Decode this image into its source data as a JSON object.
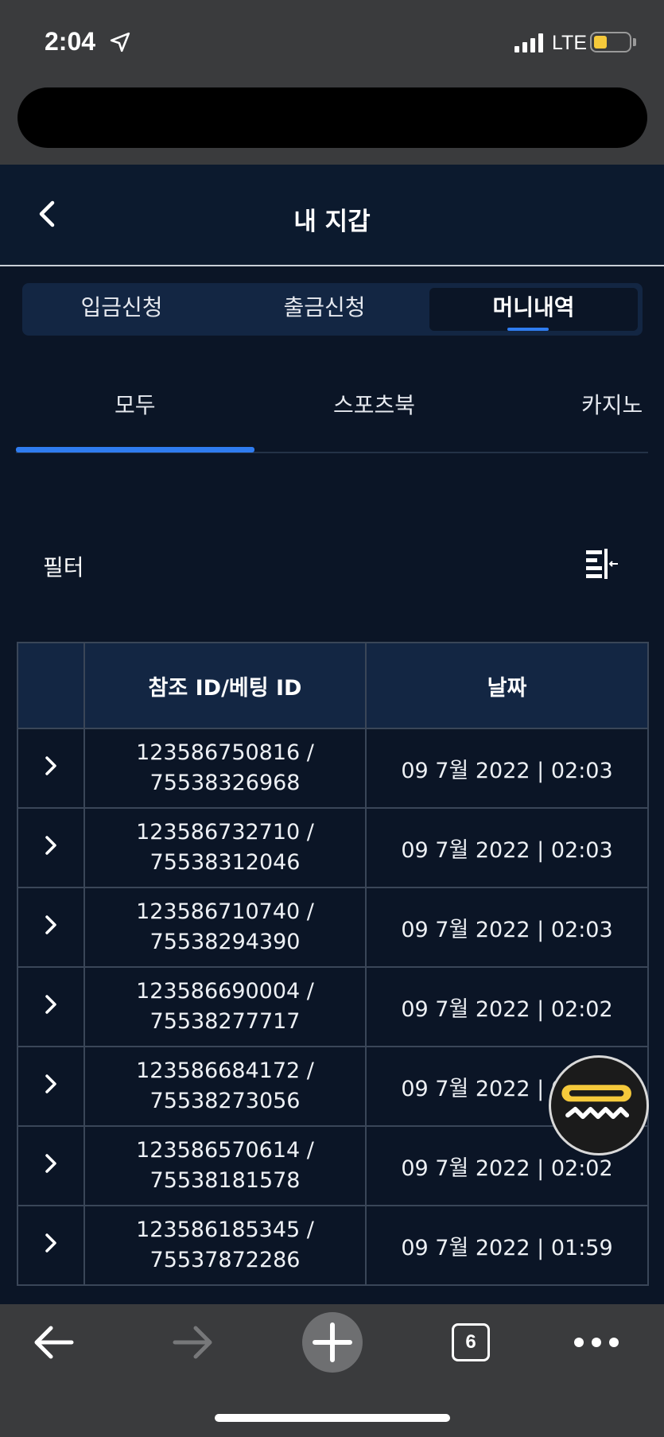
{
  "status": {
    "time": "2:04",
    "network": "LTE"
  },
  "header": {
    "title": "내 지갑"
  },
  "segments": [
    "입금신청",
    "출금신청",
    "머니내역"
  ],
  "tabs": [
    "모두",
    "스포츠북",
    "카지노"
  ],
  "filter": {
    "label": "필터"
  },
  "table": {
    "headers": [
      "",
      "참조 ID/베팅 ID",
      "날짜"
    ],
    "rows": [
      {
        "ref": "123586750816 /",
        "bet": "75538326968",
        "date": "09 7월 2022 | 02:03"
      },
      {
        "ref": "123586732710 /",
        "bet": "75538312046",
        "date": "09 7월 2022 | 02:03"
      },
      {
        "ref": "123586710740 /",
        "bet": "75538294390",
        "date": "09 7월 2022 | 02:03"
      },
      {
        "ref": "123586690004 /",
        "bet": "75538277717",
        "date": "09 7월 2022 | 02:02"
      },
      {
        "ref": "123586684172 /",
        "bet": "75538273056",
        "date": "09 7월 2022 | 02:02"
      },
      {
        "ref": "123586570614 /",
        "bet": "75538181578",
        "date": "09 7월 2022 | 02:02"
      },
      {
        "ref": "123586185345 /",
        "bet": "75537872286",
        "date": "09 7월 2022 | 01:59"
      }
    ]
  },
  "toolbar": {
    "tab_count": "6"
  },
  "colors": {
    "accent": "#2f7cf0",
    "background": "#0b1526",
    "header_row": "#132643"
  },
  "icons": [
    "location-arrow-icon",
    "signal-icon",
    "battery-icon",
    "back-chevron-icon",
    "filter-icon",
    "row-chevron-icon",
    "chat-bot-icon",
    "browser-back-icon",
    "browser-forward-icon",
    "plus-icon",
    "tabs-icon",
    "more-icon"
  ]
}
